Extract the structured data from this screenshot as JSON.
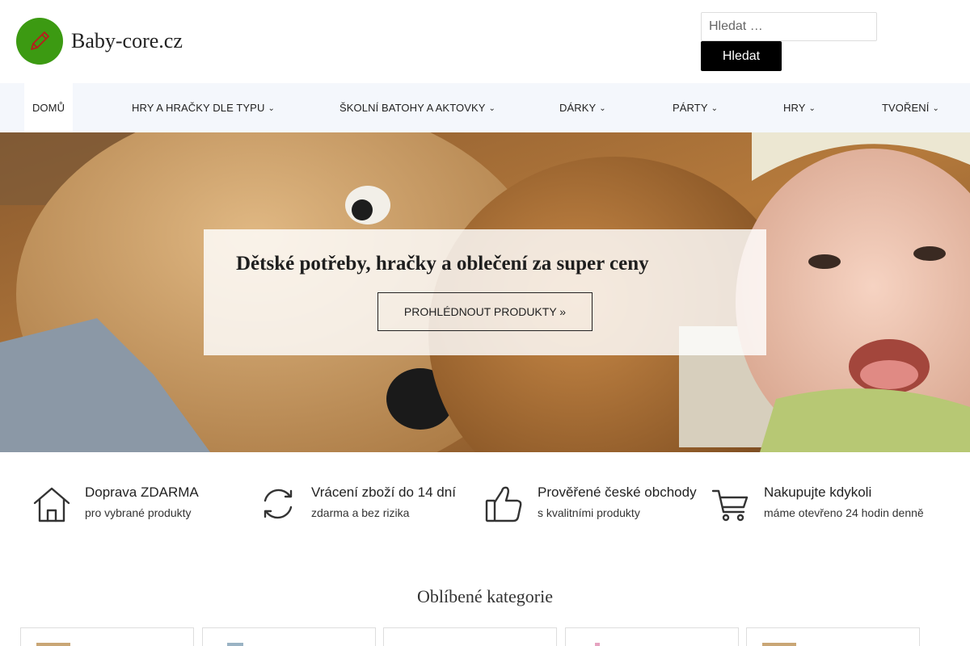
{
  "site": {
    "title": "Baby-core.cz",
    "logo_icon": "pencil-icon",
    "brand_color": "#3c9a12"
  },
  "search": {
    "placeholder": "Hledat …",
    "button_label": "Hledat"
  },
  "nav": {
    "items": [
      {
        "label": "Domů",
        "active": true
      },
      {
        "label": "Hry a hračky dle typu",
        "dropdown": true
      },
      {
        "label": "Školní batohy a aktovky",
        "dropdown": true
      },
      {
        "label": "Dárky",
        "dropdown": true
      },
      {
        "label": "Párty",
        "dropdown": true
      },
      {
        "label": "Hry",
        "dropdown": true
      },
      {
        "label": "Tvoření",
        "dropdown": true
      }
    ]
  },
  "hero": {
    "title": "Dětské potřeby, hračky a oblečení za super ceny",
    "button_label": "Prohlédnout produkty »"
  },
  "features": [
    {
      "icon": "house-icon",
      "title": "Doprava ZDARMA",
      "subtitle": "pro vybrané produkty"
    },
    {
      "icon": "refresh-icon",
      "title": "Vrácení zboží do 14 dní",
      "subtitle": "zdarma a bez rizika"
    },
    {
      "icon": "thumbs-up-icon",
      "title": "Prověřené české obchody",
      "subtitle": "s kvalitními produkty"
    },
    {
      "icon": "cart-icon",
      "title": "Nakupujte kdykoli",
      "subtitle": "máme otevřeno 24 hodin denně"
    }
  ],
  "categories": {
    "heading": "Oblíbené kategorie"
  }
}
